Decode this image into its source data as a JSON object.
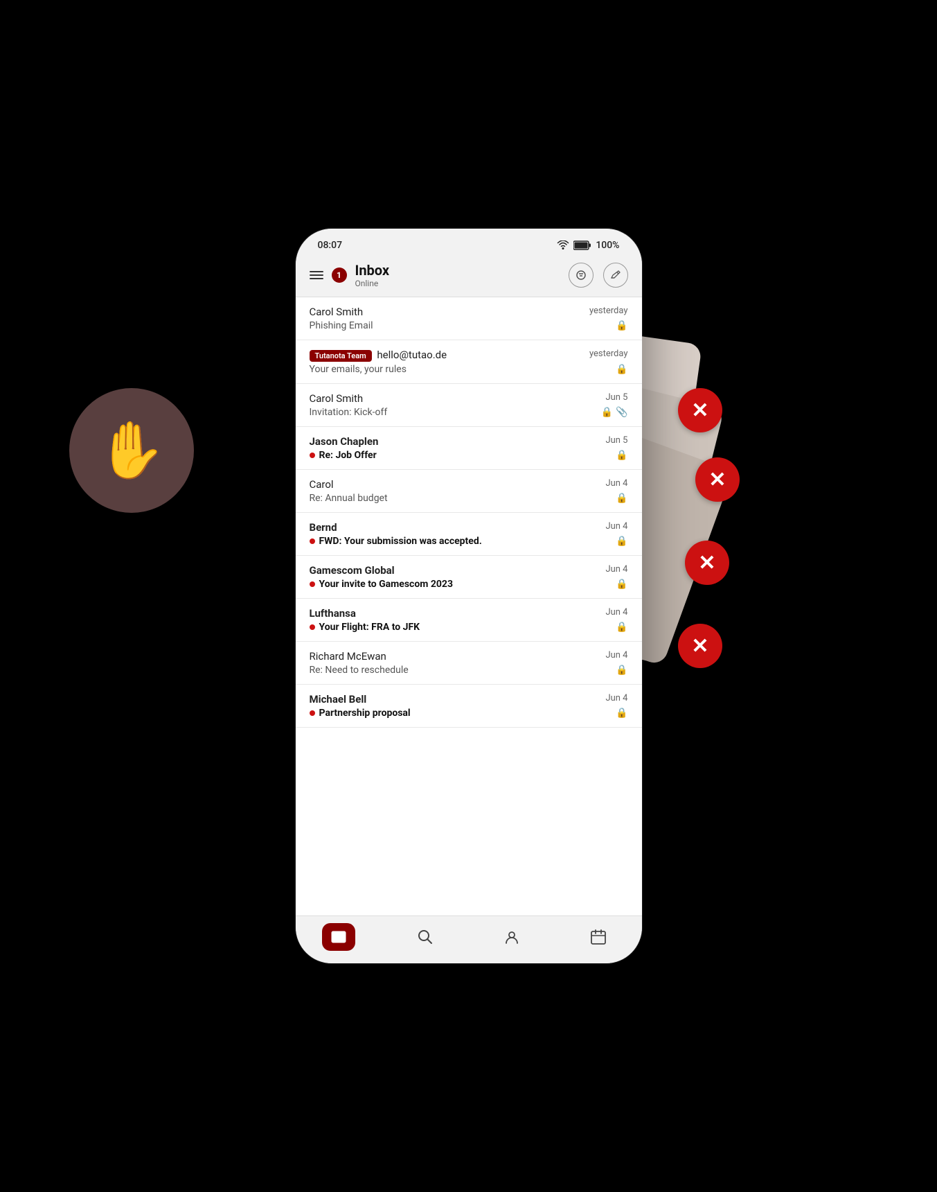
{
  "status_bar": {
    "time": "08:07",
    "battery": "100%"
  },
  "header": {
    "title": "Inbox",
    "subtitle": "Online",
    "badge": "1",
    "filter_label": "filter",
    "compose_label": "compose"
  },
  "emails": [
    {
      "sender": "Carol Smith",
      "date": "yesterday",
      "subject": "Phishing Email",
      "bold": false,
      "has_dot": false,
      "has_attachment": false,
      "has_lock": true,
      "is_tutanota": false
    },
    {
      "sender": "hello@tutao.de",
      "date": "yesterday",
      "subject": "Your emails, your rules",
      "bold": false,
      "has_dot": false,
      "has_attachment": false,
      "has_lock": true,
      "is_tutanota": true,
      "tutanota_label": "Tutanota Team"
    },
    {
      "sender": "Carol Smith",
      "date": "Jun 5",
      "subject": "Invitation: Kick-off",
      "bold": false,
      "has_dot": false,
      "has_attachment": true,
      "has_lock": true,
      "is_tutanota": false
    },
    {
      "sender": "Jason Chaplen",
      "date": "Jun 5",
      "subject": "Re: Job Offer",
      "bold": true,
      "has_dot": true,
      "has_attachment": false,
      "has_lock": true,
      "is_tutanota": false
    },
    {
      "sender": "Carol",
      "date": "Jun 4",
      "subject": "Re: Annual budget",
      "bold": false,
      "has_dot": false,
      "has_attachment": false,
      "has_lock": true,
      "is_tutanota": false
    },
    {
      "sender": "Bernd",
      "date": "Jun 4",
      "subject": "FWD: Your submission was accepted.",
      "bold": true,
      "has_dot": true,
      "has_attachment": false,
      "has_lock": true,
      "is_tutanota": false
    },
    {
      "sender": "Gamescom Global",
      "date": "Jun 4",
      "subject": "Your invite to Gamescom 2023",
      "bold": true,
      "has_dot": true,
      "has_attachment": false,
      "has_lock": true,
      "is_tutanota": false
    },
    {
      "sender": "Lufthansa",
      "date": "Jun 4",
      "subject": "Your Flight: FRA to JFK",
      "bold": true,
      "has_dot": true,
      "has_attachment": false,
      "has_lock": true,
      "is_tutanota": false
    },
    {
      "sender": "Richard McEwan",
      "date": "Jun 4",
      "subject": "Re: Need to reschedule",
      "bold": false,
      "has_dot": false,
      "has_attachment": false,
      "has_lock": true,
      "is_tutanota": false
    },
    {
      "sender": "Michael Bell",
      "date": "Jun 4",
      "subject": "Partnership proposal",
      "bold": true,
      "has_dot": true,
      "has_attachment": false,
      "has_lock": true,
      "is_tutanota": false
    }
  ],
  "nav": {
    "mail": "mail",
    "search": "search",
    "contacts": "contacts",
    "calendar": "calendar"
  },
  "colors": {
    "accent": "#8b0000",
    "unread_dot": "#cc1111"
  }
}
